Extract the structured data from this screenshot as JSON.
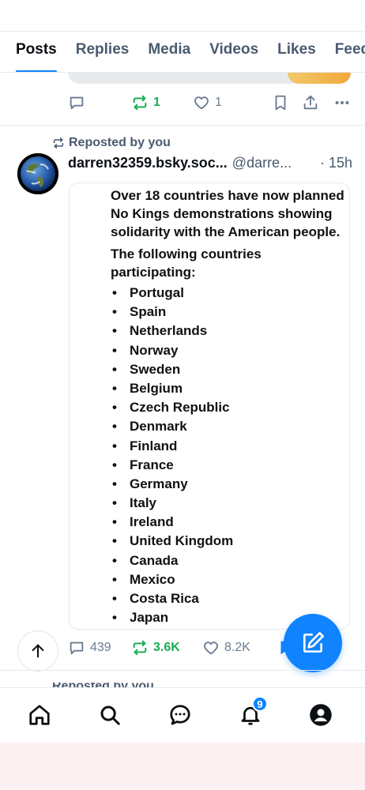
{
  "tabs": [
    "Posts",
    "Replies",
    "Media",
    "Videos",
    "Likes",
    "Feeds"
  ],
  "prev_post": {
    "reposts": "1",
    "likes": "1"
  },
  "post": {
    "repost_label": "Reposted by you",
    "author": "darren32359.bsky.soc...",
    "handle": "@darre...",
    "time": "· 15h",
    "image_text": {
      "intro": "Over 18 countries have now planned No Kings demonstrations showing solidarity with the American people.",
      "lead": "The following countries participating:",
      "countries": [
        "Portugal",
        "Spain",
        "Netherlands",
        "Norway",
        "Sweden",
        "Belgium",
        "Czech Republic",
        "Denmark",
        "Finland",
        "France",
        "Germany",
        "Italy",
        "Ireland",
        "United Kingdom",
        "Canada",
        "Mexico",
        "Costa Rica",
        "Japan"
      ]
    },
    "replies": "439",
    "reposts": "3.6K",
    "likes": "8.2K"
  },
  "next_post": {
    "repost_label": "Reposted by you"
  },
  "nav": {
    "notifications_badge": "9"
  },
  "colors": {
    "accent": "#1083fe",
    "repost_green": "#1aac55",
    "muted": "#6b7b92"
  }
}
